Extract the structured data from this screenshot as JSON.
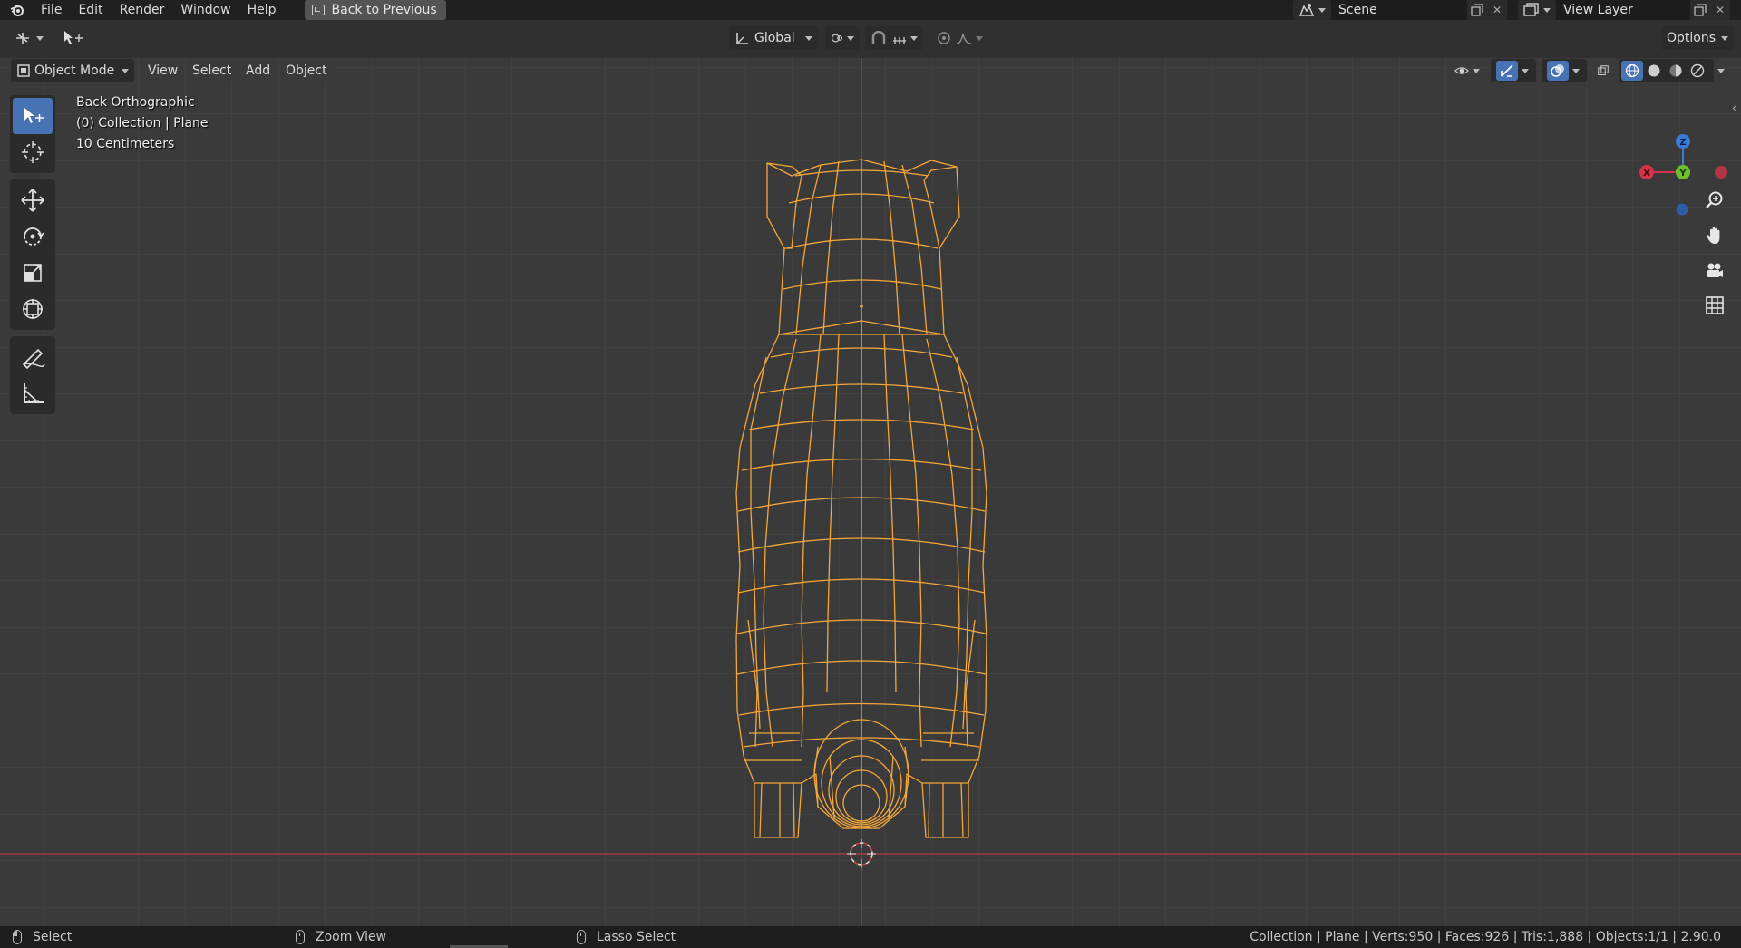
{
  "menu": {
    "items": [
      "File",
      "Edit",
      "Render",
      "Window",
      "Help"
    ],
    "back_button": "Back to Previous"
  },
  "scene": {
    "label": "Scene"
  },
  "view_layer": {
    "label": "View Layer"
  },
  "header": {
    "transform_orientation": "Global",
    "options_label": "Options",
    "mode_label": "Object Mode",
    "menus": [
      "View",
      "Select",
      "Add",
      "Object"
    ]
  },
  "viewport": {
    "view_name": "Back Orthographic",
    "collection_info": "(0) Collection | Plane",
    "grid_scale": "10 Centimeters",
    "axis_labels": {
      "z": "Z",
      "x": "X",
      "y": "Y"
    },
    "colors": {
      "background": "#3a3a3a",
      "grid": "#444444",
      "wireframe": "#f5a73a",
      "x_axis": "#c9363d",
      "z_axis": "#2f5d9e",
      "active_tool": "#4772b3"
    }
  },
  "status": {
    "left_action": "Select",
    "middle_action": "Zoom View",
    "right_action": "Lasso Select",
    "stats": "Collection | Plane | Verts:950 | Faces:926 | Tris:1,888 | Objects:1/1 | 2.90.0"
  },
  "icons": {
    "toolbar": [
      "select-box-icon",
      "cursor-icon",
      "move-icon",
      "rotate-icon",
      "scale-icon",
      "transform-icon",
      "annotate-icon",
      "measure-icon"
    ],
    "navigation": [
      "zoom-icon",
      "pan-hand-icon",
      "camera-icon",
      "grid-icon"
    ]
  }
}
